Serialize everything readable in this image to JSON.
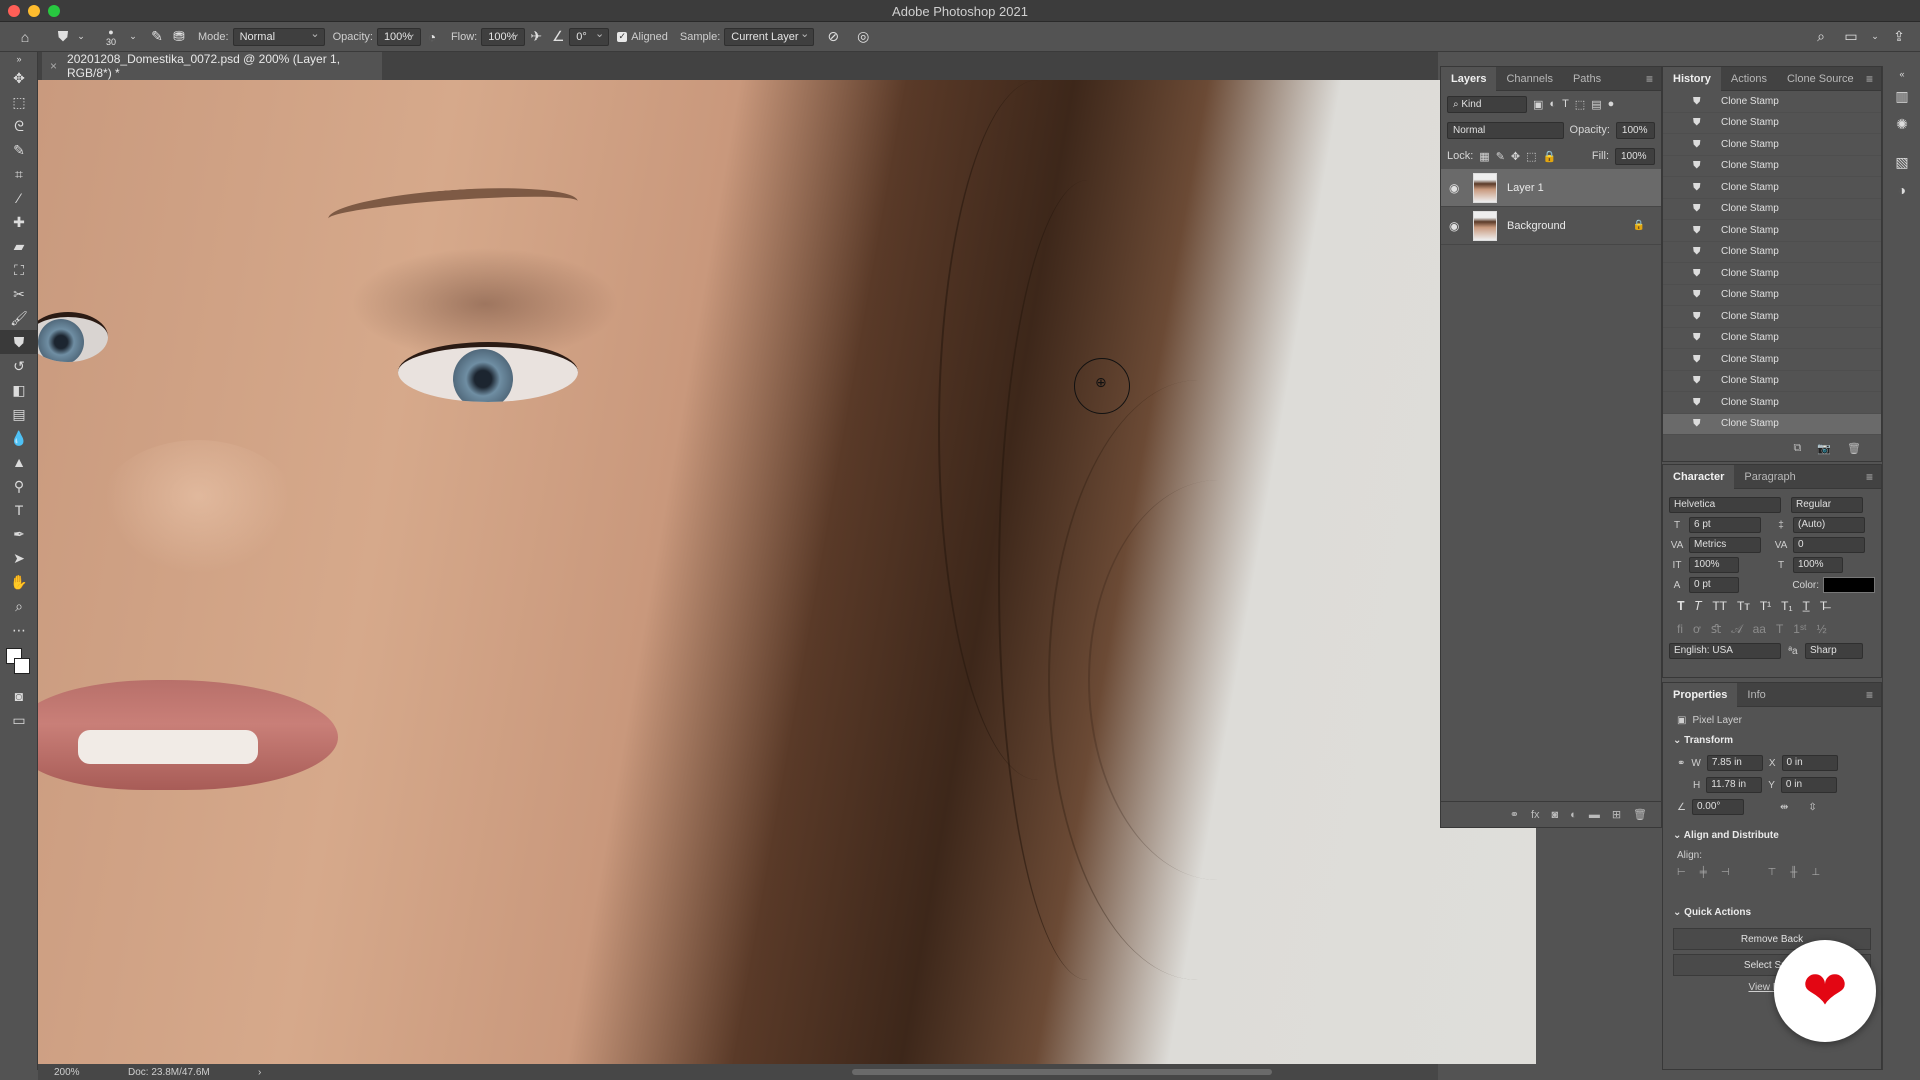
{
  "window": {
    "title": "Adobe Photoshop 2021"
  },
  "options_bar": {
    "brush_size": "30",
    "mode_label": "Mode:",
    "mode_value": "Normal",
    "opacity_label": "Opacity:",
    "opacity_value": "100%",
    "flow_label": "Flow:",
    "flow_value": "100%",
    "angle_value": "0°",
    "aligned_label": "Aligned",
    "sample_label": "Sample:",
    "sample_value": "Current Layer"
  },
  "document": {
    "tab_title": "20201208_Domestika_0072.psd @ 200% (Layer 1, RGB/8*) *",
    "zoom": "200%",
    "doc_info": "Doc: 23.8M/47.6M"
  },
  "layers_panel": {
    "tabs": [
      "Layers",
      "Channels",
      "Paths"
    ],
    "filter_kind": "Kind",
    "blend_mode": "Normal",
    "opacity_label": "Opacity:",
    "opacity_value": "100%",
    "lock_label": "Lock:",
    "fill_label": "Fill:",
    "fill_value": "100%",
    "layers": [
      {
        "name": "Layer 1",
        "selected": true
      },
      {
        "name": "Background",
        "locked": true
      }
    ]
  },
  "history_panel": {
    "tabs": [
      "History",
      "Actions",
      "Clone Source"
    ],
    "items": [
      "Clone Stamp",
      "Clone Stamp",
      "Clone Stamp",
      "Clone Stamp",
      "Clone Stamp",
      "Clone Stamp",
      "Clone Stamp",
      "Clone Stamp",
      "Clone Stamp",
      "Clone Stamp",
      "Clone Stamp",
      "Clone Stamp",
      "Clone Stamp",
      "Clone Stamp",
      "Clone Stamp",
      "Clone Stamp"
    ]
  },
  "character_panel": {
    "tabs": [
      "Character",
      "Paragraph"
    ],
    "font_family": "Helvetica",
    "font_style": "Regular",
    "font_size": "6 pt",
    "leading": "(Auto)",
    "kerning": "Metrics",
    "tracking": "0",
    "vertical_scale": "100%",
    "horizontal_scale": "100%",
    "baseline_shift": "0 pt",
    "color_label": "Color:",
    "language": "English: USA",
    "antialias": "Sharp",
    "text_color": "#000000"
  },
  "properties_panel": {
    "tabs": [
      "Properties",
      "Info"
    ],
    "layer_type": "Pixel Layer",
    "transform_label": "Transform",
    "w_label": "W",
    "w_value": "7.85 in",
    "x_label": "X",
    "x_value": "0 in",
    "h_label": "H",
    "h_value": "11.78 in",
    "y_label": "Y",
    "y_value": "0 in",
    "angle_value": "0.00°",
    "align_label": "Align and Distribute",
    "align_sub": "Align:",
    "quick_actions_label": "Quick Actions",
    "remove_bg": "Remove Back",
    "select_subject": "Select Subje",
    "view_more": "View More"
  },
  "colors": {
    "accent": "#e30613"
  }
}
